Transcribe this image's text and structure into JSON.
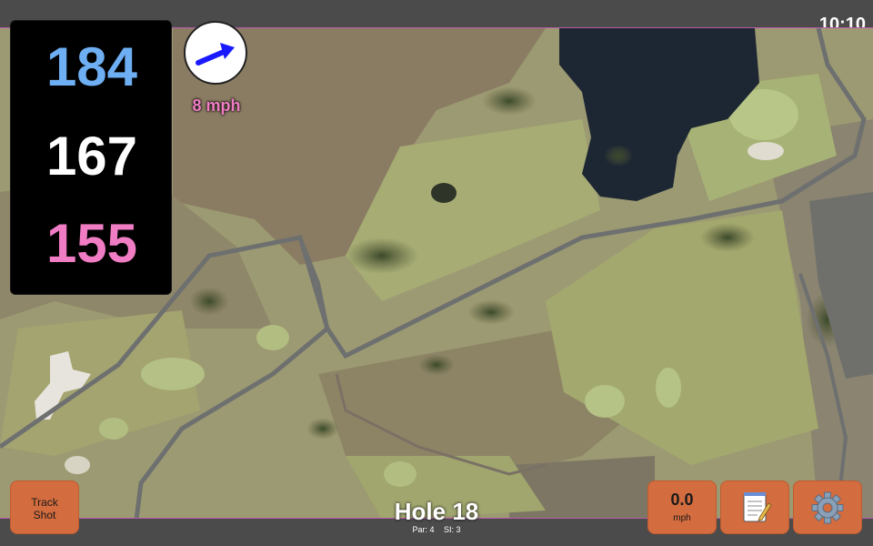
{
  "status": {
    "clock": "10:10"
  },
  "distances": {
    "back": "184",
    "middle": "167",
    "front": "155"
  },
  "wind": {
    "label": "8 mph",
    "button_value": "0.0",
    "button_unit": "mph"
  },
  "buttons": {
    "track_shot": [
      "Track",
      "Shot"
    ]
  },
  "hole": {
    "title": "Hole 18",
    "par": "Par: 4",
    "si": "SI: 3"
  },
  "icons": {
    "wind_direction": "arrow-icon",
    "notes": "notepad-icon",
    "settings": "gear-icon"
  },
  "colors": {
    "back": "#6eaef2",
    "middle": "#ffffff",
    "front": "#f07dc4",
    "button": "#d36c3e",
    "panel": "#000000",
    "map_border": "#b85aa8"
  }
}
